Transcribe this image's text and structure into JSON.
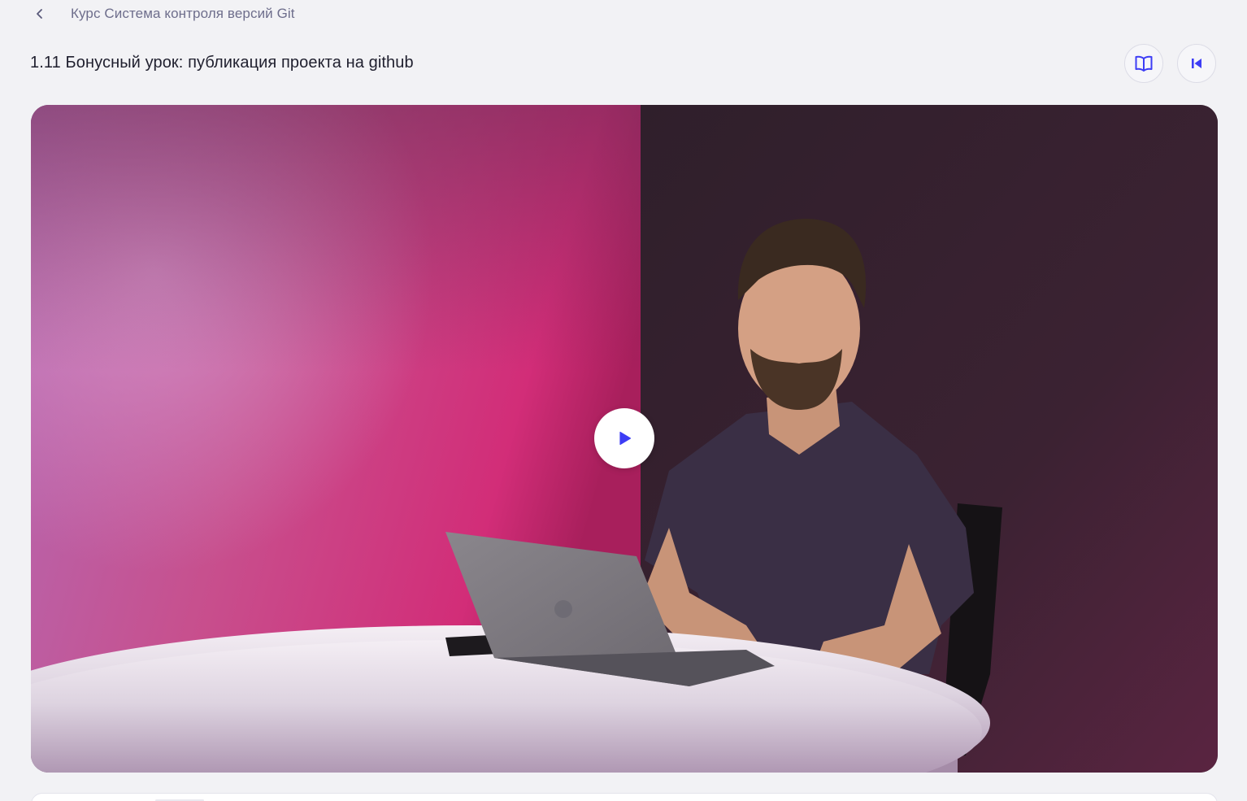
{
  "breadcrumb": {
    "back_icon": "chevron-left-icon",
    "course_link": "Курс Система контроля версий Git"
  },
  "lesson": {
    "title": "1.11 Бонусный урок: публикация проекта на github"
  },
  "actions": {
    "book_icon": "book-open-icon",
    "rewind_icon": "skip-back-icon"
  },
  "video": {
    "play_icon": "play-icon"
  },
  "colors": {
    "accent": "#3d3df5",
    "text_muted": "#6e6e8c",
    "background": "#f2f2f5"
  }
}
